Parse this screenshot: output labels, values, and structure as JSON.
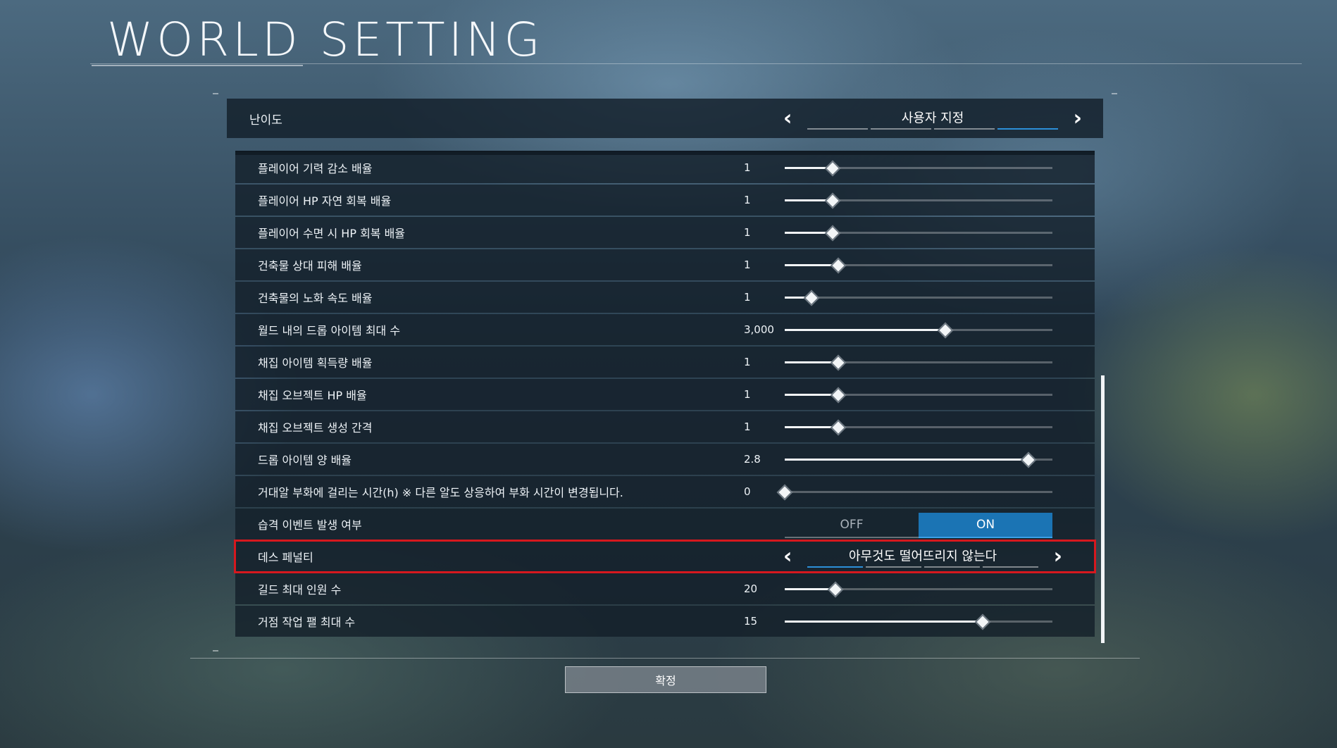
{
  "header": {
    "title": "WORLD SETTING"
  },
  "difficulty": {
    "label": "난이도",
    "value": "사용자 지정",
    "prev_icon": "‹",
    "next_icon": "›"
  },
  "settings": [
    {
      "label": "플레이어 기력 감소 배율",
      "value": "1",
      "level": 0.18,
      "type": "slider"
    },
    {
      "label": "플레이어 HP 자연 회복 배율",
      "value": "1",
      "level": 0.18,
      "type": "slider"
    },
    {
      "label": "플레이어 수면 시 HP 회복 배율",
      "value": "1",
      "level": 0.18,
      "type": "slider"
    },
    {
      "label": "건축물 상대 피해 배율",
      "value": "1",
      "level": 0.2,
      "type": "slider"
    },
    {
      "label": "건축물의 노화 속도 배율",
      "value": "1",
      "level": 0.1,
      "type": "slider"
    },
    {
      "label": "월드 내의 드롭 아이템 최대 수",
      "value": "3,000",
      "level": 0.6,
      "type": "slider"
    },
    {
      "label": "채집 아이템 획득량 배율",
      "value": "1",
      "level": 0.2,
      "type": "slider"
    },
    {
      "label": "채집 오브젝트 HP 배율",
      "value": "1",
      "level": 0.2,
      "type": "slider"
    },
    {
      "label": "채집 오브젝트 생성 간격",
      "value": "1",
      "level": 0.2,
      "type": "slider"
    },
    {
      "label": "드롭 아이템 양 배율",
      "value": "2.8",
      "level": 0.91,
      "type": "slider"
    },
    {
      "label": "거대알 부화에 걸리는 시간(h) ※ 다른 알도 상응하여 부화 시간이 변경됩니다.",
      "value": "0",
      "level": 0.0,
      "type": "slider"
    },
    {
      "label": "습격 이벤트 발생 여부",
      "type": "toggle",
      "off_label": "OFF",
      "on_label": "ON",
      "selected": "ON"
    },
    {
      "label": "데스 페널티",
      "type": "selector",
      "value": "아무것도 떨어뜨리지 않는다"
    },
    {
      "label": "길드 최대 인원 수",
      "value": "20",
      "level": 0.19,
      "type": "slider"
    },
    {
      "label": "거점 작업 팰 최대 수",
      "value": "15",
      "level": 0.74,
      "type": "slider"
    }
  ],
  "confirm": {
    "label": "확정"
  }
}
